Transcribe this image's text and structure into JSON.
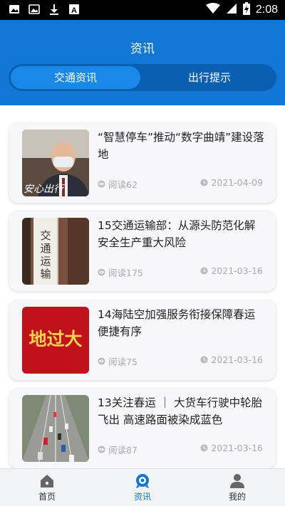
{
  "status_bar": {
    "time": "2:08",
    "left_icons": [
      "photos-icon",
      "image-icon",
      "download-icon",
      "font-icon"
    ],
    "right_icons": [
      "wifi-icon",
      "signal-icon",
      "battery-icon"
    ]
  },
  "header": {
    "title": "资讯",
    "tabs": [
      {
        "label": "交通资讯",
        "active": true
      },
      {
        "label": "出行提示",
        "active": false
      }
    ]
  },
  "colors": {
    "brand_blue": "#1277d4",
    "tab_track": "#0b5fb2",
    "tab_active": "#1a88e6"
  },
  "news": [
    {
      "title": "“智慧停车”推动“数字曲靖”建设落地",
      "reads": "阅读62",
      "date": "2021-04-09",
      "thumb_text": "安心出行"
    },
    {
      "title": "15交通运输部：从源头防范化解安全生产重大风险",
      "reads": "阅读175",
      "date": "2021-03-16",
      "thumb_text": "交通运输部"
    },
    {
      "title": "14海陆空加强服务衔接保障春运便捷有序",
      "reads": "阅读75",
      "date": "2021-03-16",
      "thumb_text": "地过大"
    },
    {
      "title": "13关注春运 ｜ 大货车行驶中轮胎飞出 高速路面被染成蓝色",
      "reads": "阅读87",
      "date": "2021-03-16",
      "thumb_text": ""
    }
  ],
  "tabbar": [
    {
      "label": "首页",
      "icon": "home-icon",
      "active": false
    },
    {
      "label": "资讯",
      "icon": "news-icon",
      "active": true
    },
    {
      "label": "我的",
      "icon": "profile-icon",
      "active": false
    }
  ]
}
